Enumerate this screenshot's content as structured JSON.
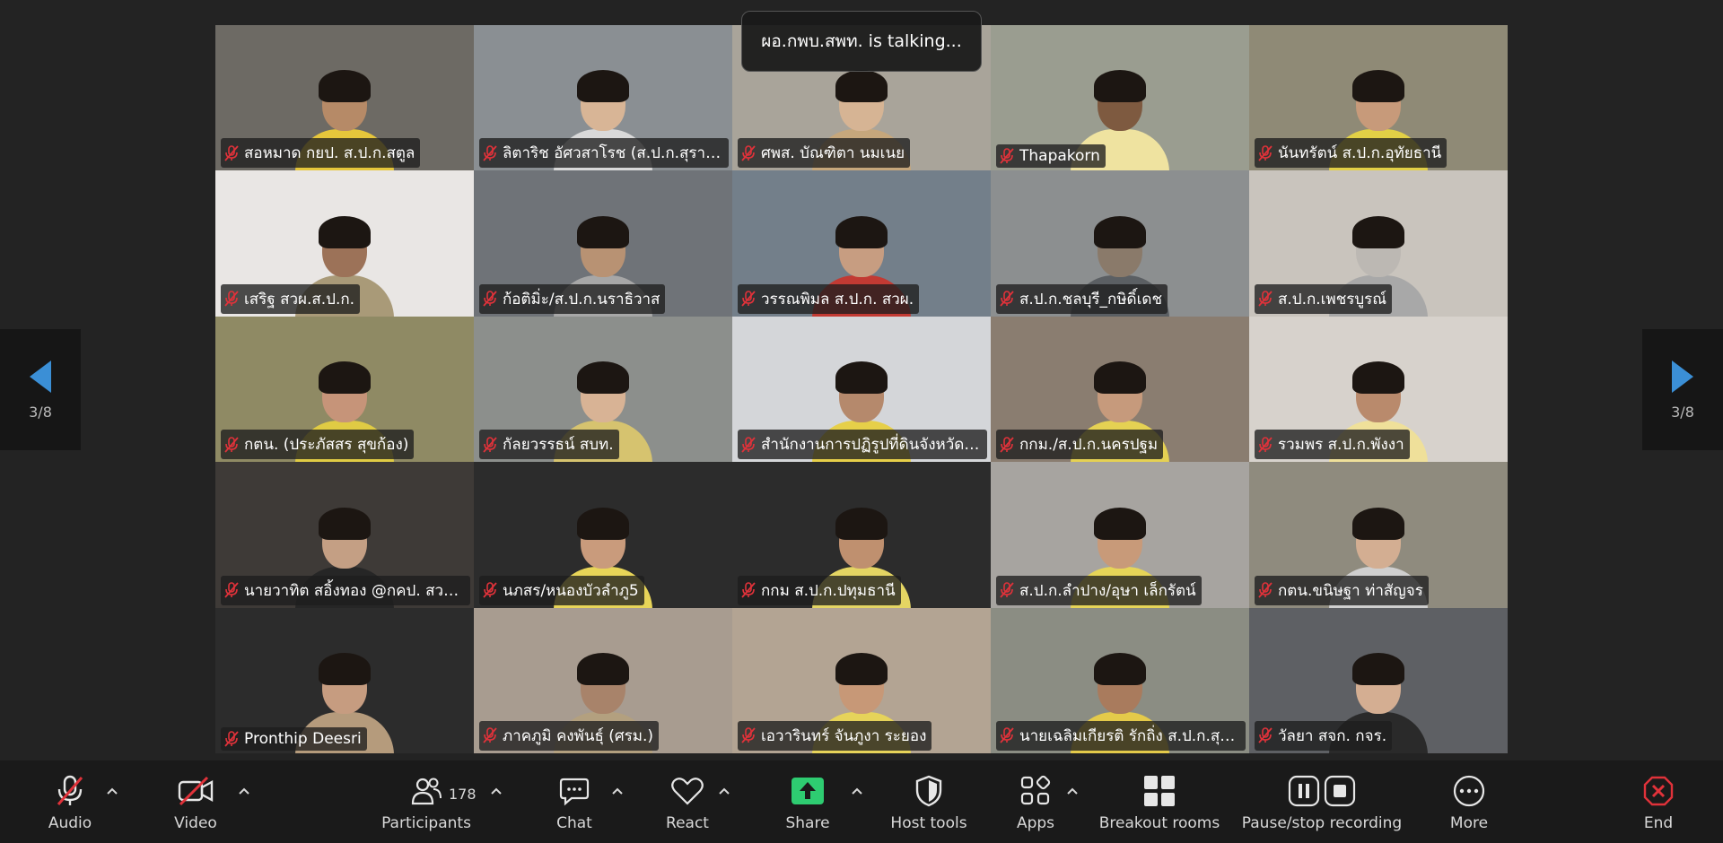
{
  "talking_indicator": "ผอ.กพบ.สพท. is talking...",
  "pagination": {
    "left_count": "3/8",
    "right_count": "3/8"
  },
  "participants": [
    {
      "name": "สอหมาด กยป. ส.ป.ก.สตูล",
      "bg": "#6d6a64",
      "shirt": "#e6c63b",
      "skin": "#b68a67"
    },
    {
      "name": "ลิตาริช อัศวสาโรช (ส.ป.ก.สุราษฎ...",
      "bg": "#8a8f93",
      "shirt": "#d9d9d9",
      "skin": "#d8b596"
    },
    {
      "name": "ศพส. บัณฑิตา นมเนย",
      "bg": "#a9a49a",
      "shirt": "#c6a77c",
      "skin": "#d6b494"
    },
    {
      "name": "Thapakorn",
      "bg": "#9a9d90",
      "shirt": "#efe3a0",
      "skin": "#7e5a40"
    },
    {
      "name": "นันทรัตน์ ส.ป.ก.อุทัยธานี",
      "bg": "#8f8a76",
      "shirt": "#e2d046",
      "skin": "#c79a7a"
    },
    {
      "name": "เสริฐ สวผ.ส.ป.ก.",
      "bg": "#e9e6e4",
      "shirt": "#a99a78",
      "skin": "#9c7258"
    },
    {
      "name": "ก้อติมิ่ะ/ส.ป.ก.นราธิวาส",
      "bg": "#6f7378",
      "shirt": "#a7a7a7",
      "skin": "#b89273"
    },
    {
      "name": "วรรณพิมล ส.ป.ก. สวผ.",
      "bg": "#737f8a",
      "shirt": "#c23a33",
      "skin": "#c79d81"
    },
    {
      "name": "ส.ป.ก.ชลบุรี_กษิดิ์เดช",
      "bg": "#8c8f90",
      "shirt": "#5b5f63",
      "skin": "#8a7a6a"
    },
    {
      "name": "ส.ป.ก.เพชรบูรณ์",
      "bg": "#c9c4bd",
      "shirt": "#a8a8a8",
      "skin": "#bcb8b3"
    },
    {
      "name": "กตน. (ประภัสสร สุขก้อง)",
      "bg": "#8f8a64",
      "shirt": "#e0cb44",
      "skin": "#c69479"
    },
    {
      "name": "กัลยวรรธน์ สบท.",
      "bg": "#8c8f8c",
      "shirt": "#d6c36f",
      "skin": "#d8b395"
    },
    {
      "name": "สำนักงานการปฏิรูปที่ดินจังหวัดกา...",
      "bg": "#d4d6d9",
      "shirt": "#e6cf49",
      "skin": "#b5896c"
    },
    {
      "name": "กกม./ส.ป.ก.นครปฐม",
      "bg": "#8a7d70",
      "shirt": "#e5d153",
      "skin": "#c69a7c"
    },
    {
      "name": "รวมพร ส.ป.ก.พังงา",
      "bg": "#d7d2cc",
      "shirt": "#efe09a",
      "skin": "#b98a6c"
    },
    {
      "name": "นายวาทิต สอิ้งทอง @กคป. สวผ. ...",
      "bg": "#3e3a37",
      "shirt": "#262626",
      "skin": "#c49f84"
    },
    {
      "name": "นภสร/หนองบัวลำภู5",
      "bg": "#2c2c2c",
      "shirt": "#e8d558",
      "skin": "#c99b7c"
    },
    {
      "name": "กกม ส.ป.ก.ปทุมธานี",
      "bg": "#2c2c2c",
      "shirt": "#e4d563",
      "skin": "#bf906f"
    },
    {
      "name": "ส.ป.ก.ลำปาง/อุษา เล็กรัตน์",
      "bg": "#a7a4a0",
      "shirt": "#e6d558",
      "skin": "#c89a79"
    },
    {
      "name": "กตน.ขนิษฐา ท่าสัญจร",
      "bg": "#8f8b7e",
      "shirt": "#cfcfcf",
      "skin": "#d3ae92"
    },
    {
      "name": "Pronthip Deesri",
      "bg": "#2c2c2c",
      "shirt": "#b59b7c",
      "skin": "#c69c80"
    },
    {
      "name": "ภาคภูมิ คงพันธุ์ (ศรม.)",
      "bg": "#a89c90",
      "shirt": "#b3a07f",
      "skin": "#a8836a"
    },
    {
      "name": "เอวารินทร์ จันภูงา ระยอง",
      "bg": "#b3a493",
      "shirt": "#e6d35a",
      "skin": "#c79877"
    },
    {
      "name": "นายเฉลิมเกียรติ รักถิ่ง ส.ป.ก.สุโขทัย",
      "bg": "#8b8d83",
      "shirt": "#e4ca4a",
      "skin": "#a97b5d"
    },
    {
      "name": "วัลยา สจก. กจร.",
      "bg": "#5e6064",
      "shirt": "#2a2a2a",
      "skin": "#d4ae92"
    }
  ],
  "toolbar": {
    "audio": "Audio",
    "video": "Video",
    "participants": "Participants",
    "participants_count": "178",
    "chat": "Chat",
    "react": "React",
    "share": "Share",
    "host_tools": "Host tools",
    "apps": "Apps",
    "breakout_rooms": "Breakout rooms",
    "recording": "Pause/stop recording",
    "more": "More",
    "end": "End"
  },
  "colors": {
    "share_green": "#2ecc71",
    "muted_red": "#e0323a",
    "pager_arrow": "#3b8fd6"
  }
}
